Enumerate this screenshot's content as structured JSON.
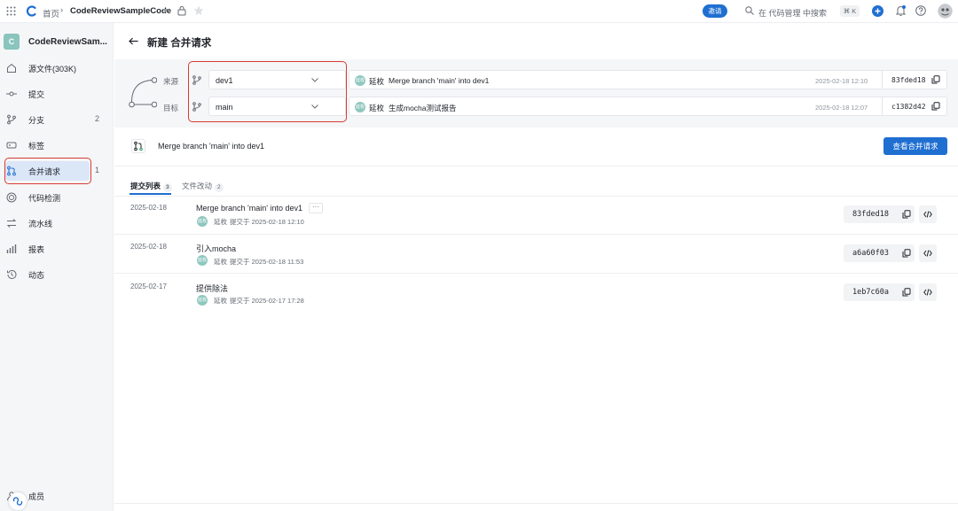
{
  "topbar": {
    "home": "首页",
    "repo": "CodeReviewSampleCode",
    "invite": "邀请",
    "search_placeholder": "在 代码管理 中搜索",
    "shortcut": "⌘ K"
  },
  "sidebar": {
    "avatar_letter": "C",
    "repo_title": "CodeReviewSam...",
    "items": [
      {
        "label": "源文件(303K)",
        "count": ""
      },
      {
        "label": "提交",
        "count": ""
      },
      {
        "label": "分支",
        "count": "2"
      },
      {
        "label": "标签",
        "count": ""
      },
      {
        "label": "合并请求",
        "count": "1"
      },
      {
        "label": "代码检测",
        "count": ""
      },
      {
        "label": "流水线",
        "count": ""
      },
      {
        "label": "报表",
        "count": ""
      },
      {
        "label": "动态",
        "count": ""
      }
    ],
    "bottom_label": "成员"
  },
  "page": {
    "title": "新建 合并请求"
  },
  "compare": {
    "source_label": "来源",
    "target_label": "目标",
    "source_branch": "dev1",
    "target_branch": "main",
    "source_commit": {
      "author": "延枚",
      "avatar_text": "延枚",
      "message": "Merge branch 'main' into dev1",
      "date": "2025-02-18 12:10",
      "hash": "83fded18"
    },
    "target_commit": {
      "author": "延枚",
      "avatar_text": "延枚",
      "message": "生成mocha测试报告",
      "date": "2025-02-18 12:07",
      "hash": "c1382d42"
    }
  },
  "merge": {
    "title": "Merge branch 'main' into dev1",
    "view_button": "查看合并请求"
  },
  "tabs": [
    {
      "label": "提交列表",
      "count": "3"
    },
    {
      "label": "文件改动",
      "count": "2"
    }
  ],
  "commits": [
    {
      "date": "2025-02-18",
      "title": "Merge branch 'main' into dev1",
      "author": "延枚",
      "avatar_text": "延枚",
      "meta": "提交于 2025-02-18 12:10",
      "hash": "83fded18"
    },
    {
      "date": "2025-02-18",
      "title": "引入mocha",
      "author": "延枚",
      "avatar_text": "延枚",
      "meta": "提交于 2025-02-18 11:53",
      "hash": "a6a60f03"
    },
    {
      "date": "2025-02-17",
      "title": "提供除法",
      "author": "延枚",
      "avatar_text": "延枚",
      "meta": "提交于 2025-02-17 17:28",
      "hash": "1eb7c60a"
    }
  ],
  "more_button": "···",
  "colors": {
    "accent": "#1f6fd1",
    "highlight_red": "#d83b35",
    "sidebar_bg": "#f5f6f7"
  }
}
